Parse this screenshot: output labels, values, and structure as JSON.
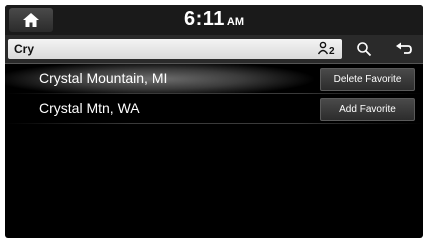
{
  "status_bar": {
    "home_icon": "home-icon",
    "time": "6:11",
    "ampm": "AM"
  },
  "search": {
    "query": "Cry",
    "voice_icon": "voice-search-icon",
    "search_icon": "search-icon",
    "back_icon": "back-icon"
  },
  "results": [
    {
      "label": "Crystal Mountain, MI",
      "action": "Delete Favorite",
      "selected": true
    },
    {
      "label": "Crystal Mtn, WA",
      "action": "Add Favorite",
      "selected": false
    }
  ]
}
